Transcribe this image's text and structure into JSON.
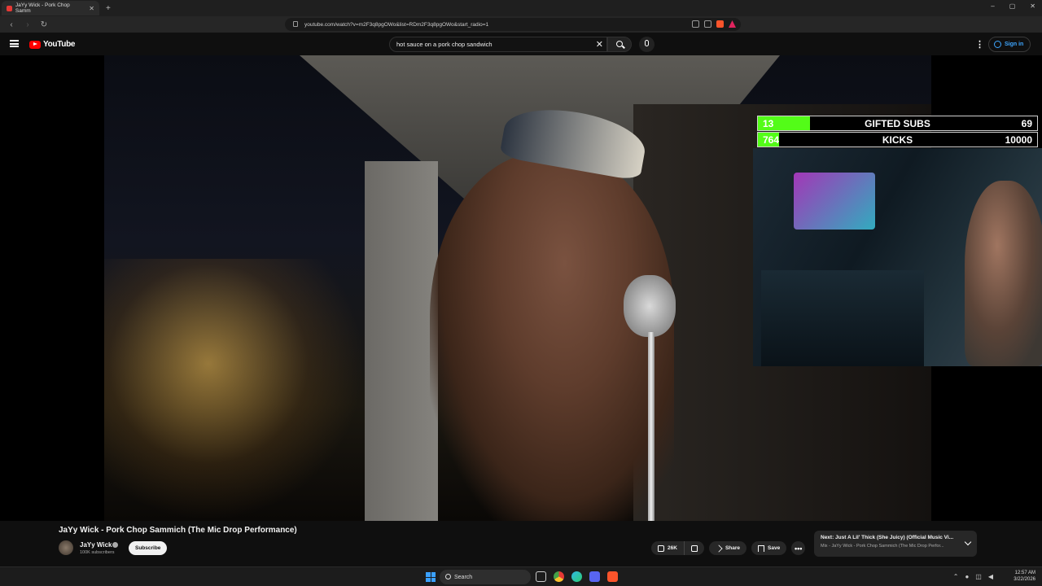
{
  "browser": {
    "tab_title": "JaYy Wick - Pork Chop Samm",
    "url": "youtube.com/watch?v=m2F3q8pgOWo&list=RDm2F3q8pgOWo&start_radio=1",
    "window_controls": [
      "–",
      "▢",
      "✕"
    ]
  },
  "youtube": {
    "logo_text": "YouTube",
    "search_value": "hot sauce on a pork chop sandwich",
    "sign_in_label": "Sign in"
  },
  "overlay": {
    "goals": [
      {
        "current": "13",
        "label": "GIFTED SUBS",
        "target": "69",
        "fill_percent": 18.8,
        "color": "#53fc18"
      },
      {
        "current": "764",
        "label": "KICKS",
        "target": "10000",
        "fill_percent": 7.6,
        "color": "#53fc18"
      }
    ]
  },
  "video": {
    "title": "JaYy Wick - Pork Chop Sammich (The Mic Drop Performance)",
    "channel": "JaYy Wick",
    "subscribers": "100K subscribers",
    "subscribe_label": "Subscribe",
    "likes": "26K",
    "share_label": "Share",
    "save_label": "Save",
    "more_label": "•••"
  },
  "next_up": {
    "title": "Next: Just A Lil' Thick (She Juicy) (Official Music Vi...",
    "subtitle": "Mix - JaYy Wick - Pork Chop Sammich (The Mic Drop Perfor..."
  },
  "taskbar": {
    "search_label": "Search",
    "time": "12:57 AM",
    "date": "3/22/2026"
  }
}
